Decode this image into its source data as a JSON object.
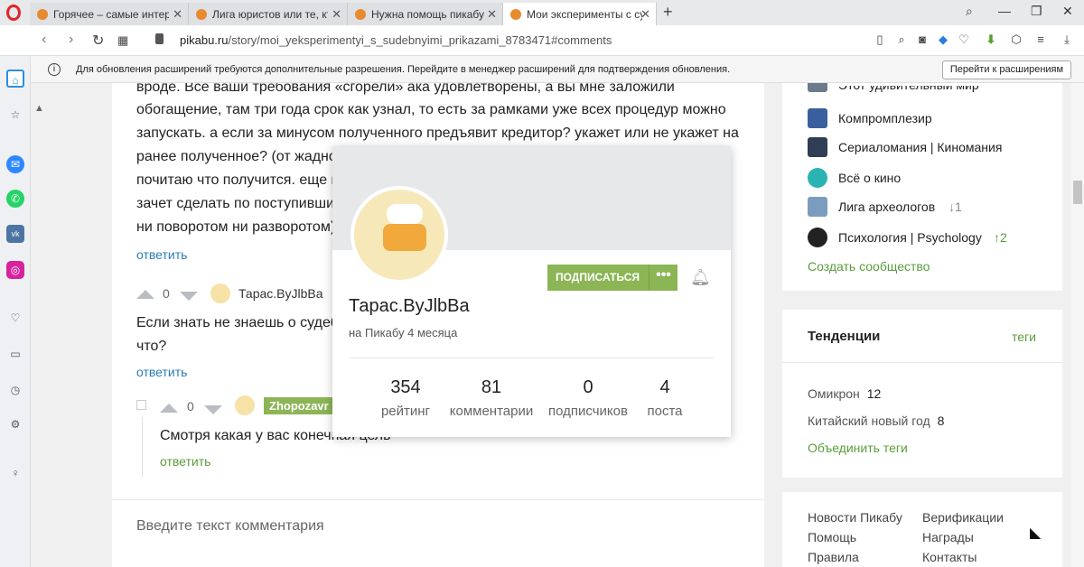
{
  "tabs": [
    {
      "title": "Горячее – самые интерес"
    },
    {
      "title": "Лига юристов или те, кто"
    },
    {
      "title": "Нужна помощь пикабу ли"
    },
    {
      "title": "Мои эксперименты с суде"
    }
  ],
  "address": {
    "domain": "pikabu.ru",
    "path": "/story/moi_yeksperimentyi_s_sudebnyimi_prikazami_8783471#comments"
  },
  "infobar": {
    "message": "Для обновления расширений требуются дополнительные разрешения. Перейдите в менеджер расширений для подтверждения обновления.",
    "button": "Перейти к расширениям"
  },
  "comment1": {
    "lines": [
      "вроде. Все ваши требования «сгорели» ака удовлетворены, а вы мне заложили",
      "обогащение, там три года срок как узнал, то есть за рамками уже всех процедур можно",
      "запускать. а если за минусом полученного предъявит кредитор? укажет или не укажет на",
      "ранее полученное? (от жадности                                                                             и",
      "почитаю что получится. еще м",
      "зачет сделать по поступивши                                                                                      к,",
      "ни поворотом ни разворотом)"
    ],
    "reply": "ответить"
  },
  "comment2": {
    "score": "0",
    "user": "Тарас.ByJlbBa",
    "lines": [
      "Если знать не знаешь о судебн",
      "что?"
    ],
    "reply": "ответить"
  },
  "comment3": {
    "score": "0",
    "user": "Zhopozavr",
    "text": "Смотря какая у вас конечная цель",
    "reply": "ответить"
  },
  "comment_input_placeholder": "Введите текст комментария",
  "popup": {
    "subscribe": "ПОДПИСАТЬСЯ",
    "more": "•••",
    "name": "Тарас.ByJlbBa",
    "since": "на Пикабу 4 месяца",
    "stats": [
      {
        "value": "354",
        "label": "рейтинг"
      },
      {
        "value": "81",
        "label": "комментарии"
      },
      {
        "value": "0",
        "label": "подписчиков"
      },
      {
        "value": "4",
        "label": "поста"
      }
    ]
  },
  "communities": [
    {
      "name": "Этот удивительный мир",
      "color": "#6a7a8c"
    },
    {
      "name": "Компромплезир",
      "color": "#3a5f9e"
    },
    {
      "name": "Сериаломания | Киномания",
      "color": "#2f3d55"
    },
    {
      "name": "Всё о кино",
      "color": "#2bb3b1"
    },
    {
      "name": "Лига археологов",
      "badge": "↓1",
      "color": "#7a9dbf"
    },
    {
      "name": "Психология | Psychology",
      "badge": "↑2",
      "color": "#222222"
    }
  ],
  "create_community": "Создать сообщество",
  "trends": {
    "title": "Тенденции",
    "link": "теги",
    "items": [
      {
        "name": "Омикрон",
        "count": "12"
      },
      {
        "name": "Китайский новый год",
        "count": "8"
      }
    ],
    "merge": "Объединить теги"
  },
  "footer": {
    "col1": [
      "Новости Пикабу",
      "Помощь",
      "Правила"
    ],
    "col2": [
      "Верификации",
      "Награды",
      "Контакты"
    ]
  }
}
